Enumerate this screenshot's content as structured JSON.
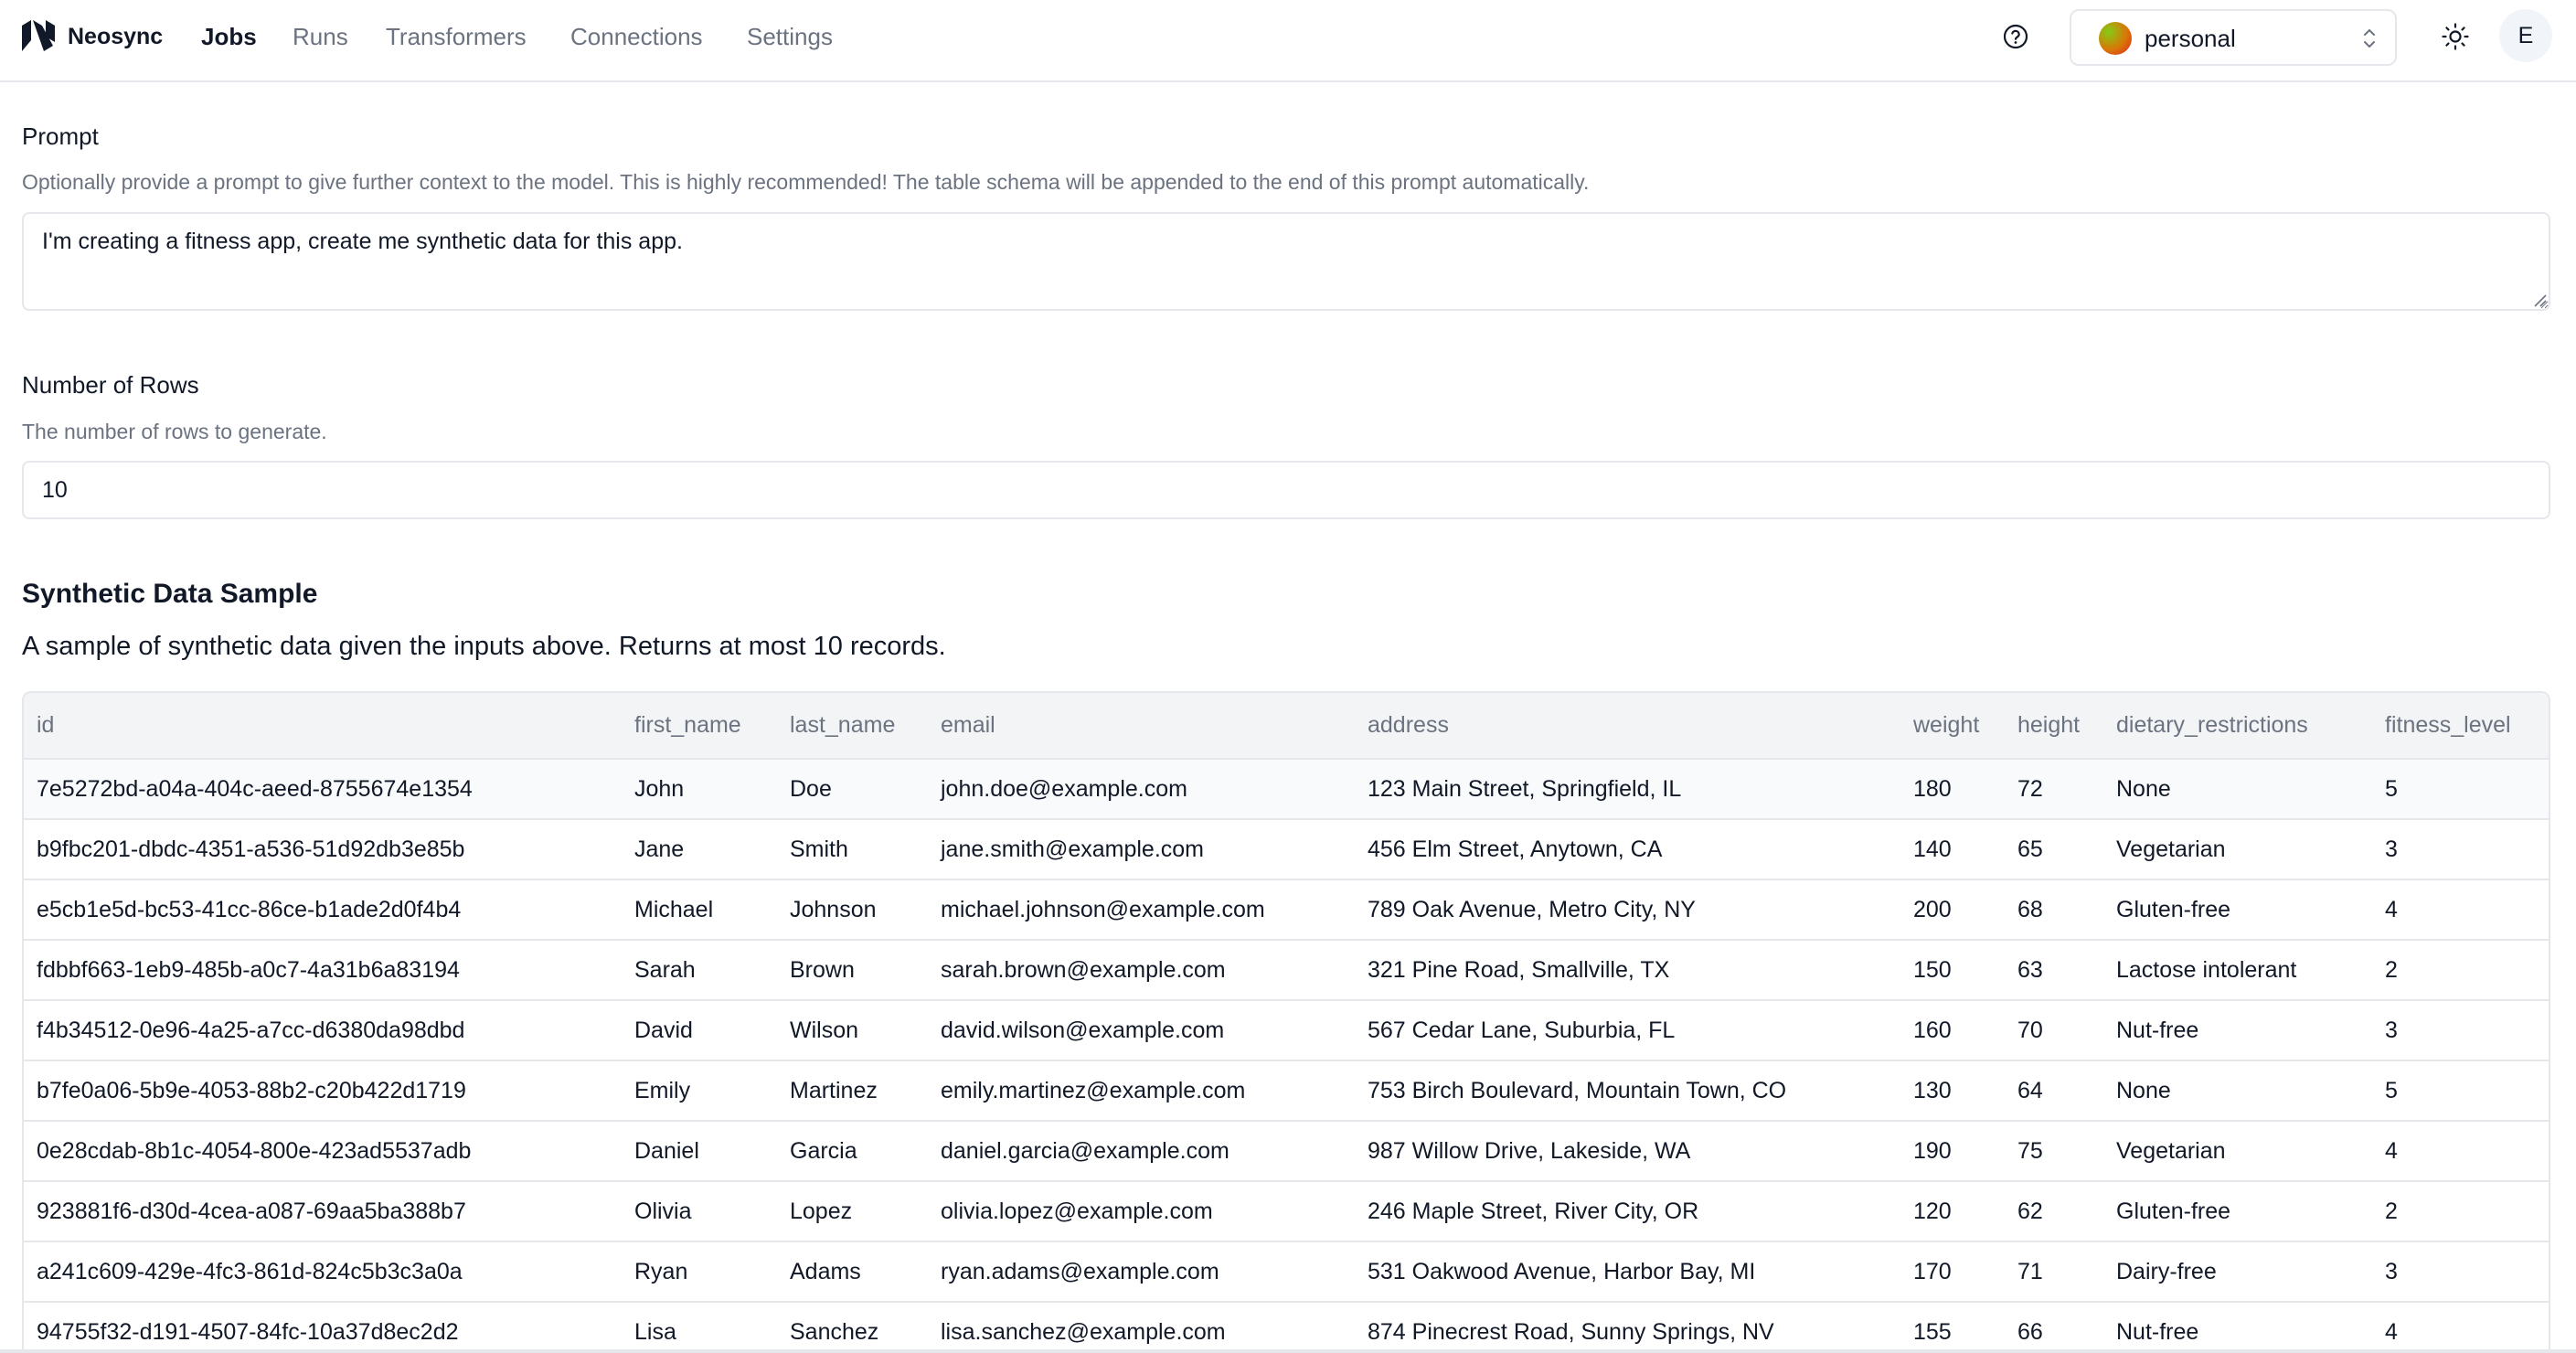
{
  "nav": {
    "brand": "Neosync",
    "links": [
      {
        "label": "Jobs",
        "active": true
      },
      {
        "label": "Runs",
        "active": false
      },
      {
        "label": "Transformers",
        "active": false
      },
      {
        "label": "Connections",
        "active": false
      },
      {
        "label": "Settings",
        "active": false
      }
    ],
    "workspace": "personal",
    "user_initial": "E",
    "icons": {
      "help": "help-circle-icon",
      "theme": "sun-icon",
      "chevron": "chevron-up-down-icon"
    }
  },
  "prompt": {
    "label": "Prompt",
    "description": "Optionally provide a prompt to give further context to the model. This is highly recommended! The table schema will be appended to the end of this prompt automatically.",
    "value": "I'm creating a fitness app, create me synthetic data for this app."
  },
  "rows": {
    "label": "Number of Rows",
    "description": "The number of rows to generate.",
    "value": "10"
  },
  "sample": {
    "title": "Synthetic Data Sample",
    "description": "A sample of synthetic data given the inputs above. Returns at most 10 records.",
    "columns": [
      "id",
      "first_name",
      "last_name",
      "email",
      "address",
      "weight",
      "height",
      "dietary_restrictions",
      "fitness_level"
    ],
    "records": [
      [
        "7e5272bd-a04a-404c-aeed-8755674e1354",
        "John",
        "Doe",
        "john.doe@example.com",
        "123 Main Street, Springfield, IL",
        "180",
        "72",
        "None",
        "5"
      ],
      [
        "b9fbc201-dbdc-4351-a536-51d92db3e85b",
        "Jane",
        "Smith",
        "jane.smith@example.com",
        "456 Elm Street, Anytown, CA",
        "140",
        "65",
        "Vegetarian",
        "3"
      ],
      [
        "e5cb1e5d-bc53-41cc-86ce-b1ade2d0f4b4",
        "Michael",
        "Johnson",
        "michael.johnson@example.com",
        "789 Oak Avenue, Metro City, NY",
        "200",
        "68",
        "Gluten-free",
        "4"
      ],
      [
        "fdbbf663-1eb9-485b-a0c7-4a31b6a83194",
        "Sarah",
        "Brown",
        "sarah.brown@example.com",
        "321 Pine Road, Smallville, TX",
        "150",
        "63",
        "Lactose intolerant",
        "2"
      ],
      [
        "f4b34512-0e96-4a25-a7cc-d6380da98dbd",
        "David",
        "Wilson",
        "david.wilson@example.com",
        "567 Cedar Lane, Suburbia, FL",
        "160",
        "70",
        "Nut-free",
        "3"
      ],
      [
        "b7fe0a06-5b9e-4053-88b2-c20b422d1719",
        "Emily",
        "Martinez",
        "emily.martinez@example.com",
        "753 Birch Boulevard, Mountain Town, CO",
        "130",
        "64",
        "None",
        "5"
      ],
      [
        "0e28cdab-8b1c-4054-800e-423ad5537adb",
        "Daniel",
        "Garcia",
        "daniel.garcia@example.com",
        "987 Willow Drive, Lakeside, WA",
        "190",
        "75",
        "Vegetarian",
        "4"
      ],
      [
        "923881f6-d30d-4cea-a087-69aa5ba388b7",
        "Olivia",
        "Lopez",
        "olivia.lopez@example.com",
        "246 Maple Street, River City, OR",
        "120",
        "62",
        "Gluten-free",
        "2"
      ],
      [
        "a241c609-429e-4fc3-861d-824c5b3c3a0a",
        "Ryan",
        "Adams",
        "ryan.adams@example.com",
        "531 Oakwood Avenue, Harbor Bay, MI",
        "170",
        "71",
        "Dairy-free",
        "3"
      ],
      [
        "94755f32-d191-4507-84fc-10a37d8ec2d2",
        "Lisa",
        "Sanchez",
        "lisa.sanchez@example.com",
        "874 Pinecrest Road, Sunny Springs, NV",
        "155",
        "66",
        "Nut-free",
        "4"
      ]
    ]
  }
}
